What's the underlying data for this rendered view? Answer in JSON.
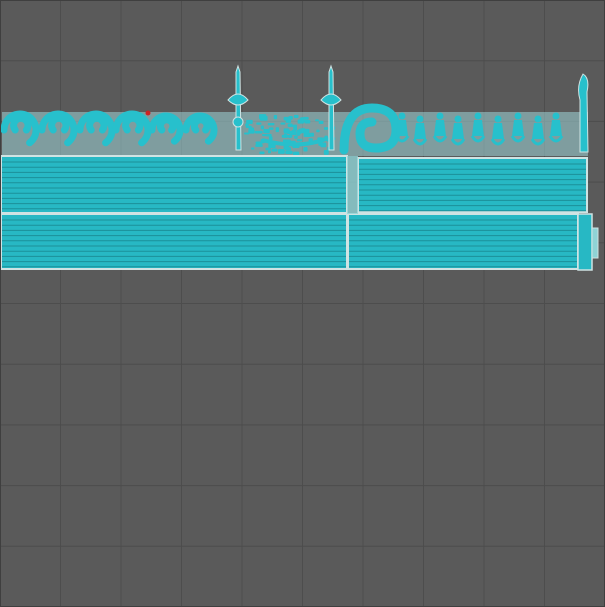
{
  "scene": {
    "background_color": "#5a5a5a",
    "grid_line_color": "#4d4d4d",
    "border_color": "#3f3f3f",
    "panel_fill_color": "#27b8c4",
    "panel_outline_color": "#cfe3e3",
    "decor_fill_color": "#27c0cc",
    "infill_line_color": "#1c8f99",
    "marker_color": "#cc2222",
    "grid_visible": true
  }
}
